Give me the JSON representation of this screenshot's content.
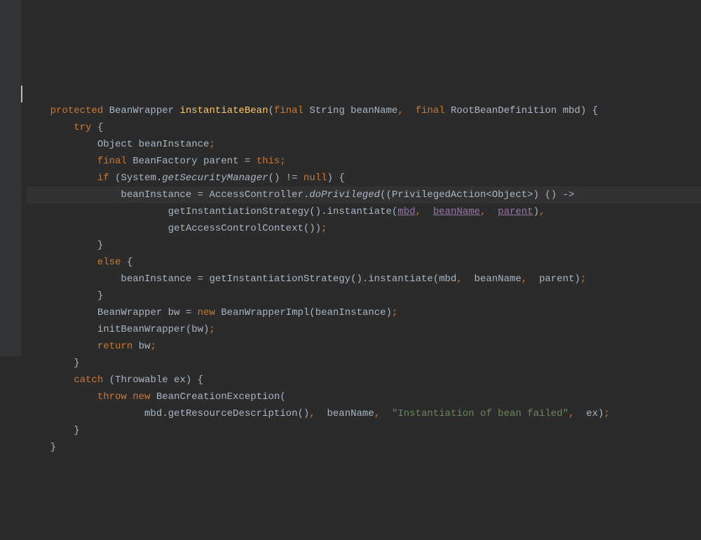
{
  "code": {
    "lines": [
      {
        "indent": 1,
        "tokens": [
          {
            "t": "protected ",
            "c": "kw"
          },
          {
            "t": "BeanWrapper ",
            "c": ""
          },
          {
            "t": "instantiateBean",
            "c": "method-decl"
          },
          {
            "t": "(",
            "c": ""
          },
          {
            "t": "final ",
            "c": "kw"
          },
          {
            "t": "String beanName",
            "c": ""
          },
          {
            "t": ", ",
            "c": "kw"
          },
          {
            "t": " ",
            "c": ""
          },
          {
            "t": "final ",
            "c": "kw"
          },
          {
            "t": "RootBeanDefinition mbd) {",
            "c": ""
          }
        ]
      },
      {
        "indent": 2,
        "tokens": [
          {
            "t": "try ",
            "c": "kw"
          },
          {
            "t": "{",
            "c": ""
          }
        ]
      },
      {
        "indent": 3,
        "tokens": [
          {
            "t": "Object beanInstance",
            "c": ""
          },
          {
            "t": ";",
            "c": "kw"
          }
        ]
      },
      {
        "indent": 3,
        "tokens": [
          {
            "t": "final ",
            "c": "kw"
          },
          {
            "t": "BeanFactory parent = ",
            "c": ""
          },
          {
            "t": "this;",
            "c": "kw"
          }
        ]
      },
      {
        "indent": 3,
        "tokens": [
          {
            "t": "if ",
            "c": "kw"
          },
          {
            "t": "(System.",
            "c": ""
          },
          {
            "t": "getSecurityManager",
            "c": "italic"
          },
          {
            "t": "() != ",
            "c": ""
          },
          {
            "t": "null",
            "c": "kw"
          },
          {
            "t": ") {",
            "c": ""
          }
        ]
      },
      {
        "indent": 4,
        "highlight": true,
        "tokens": [
          {
            "t": "beanInstance = AccessController.",
            "c": ""
          },
          {
            "t": "doPrivileged",
            "c": "italic"
          },
          {
            "t": "((PrivilegedAction<Object>) () ->",
            "c": ""
          }
        ]
      },
      {
        "indent": 6,
        "tokens": [
          {
            "t": "getInstantiationStrategy().instantiate(",
            "c": ""
          },
          {
            "t": "mbd",
            "c": "param-underline"
          },
          {
            "t": ", ",
            "c": "kw"
          },
          {
            "t": " ",
            "c": ""
          },
          {
            "t": "beanName",
            "c": "param-underline"
          },
          {
            "t": ", ",
            "c": "kw"
          },
          {
            "t": " ",
            "c": ""
          },
          {
            "t": "parent",
            "c": "param-underline"
          },
          {
            "t": ")",
            "c": ""
          },
          {
            "t": ",",
            "c": "kw"
          }
        ]
      },
      {
        "indent": 6,
        "tokens": [
          {
            "t": "getAccessControlContext())",
            "c": ""
          },
          {
            "t": ";",
            "c": "kw"
          }
        ]
      },
      {
        "indent": 3,
        "tokens": [
          {
            "t": "}",
            "c": ""
          }
        ]
      },
      {
        "indent": 3,
        "tokens": [
          {
            "t": "else ",
            "c": "kw"
          },
          {
            "t": "{",
            "c": ""
          }
        ]
      },
      {
        "indent": 4,
        "tokens": [
          {
            "t": "beanInstance = getInstantiationStrategy().instantiate(mbd",
            "c": ""
          },
          {
            "t": ", ",
            "c": "kw"
          },
          {
            "t": " beanName",
            "c": ""
          },
          {
            "t": ", ",
            "c": "kw"
          },
          {
            "t": " parent)",
            "c": ""
          },
          {
            "t": ";",
            "c": "kw"
          }
        ]
      },
      {
        "indent": 3,
        "tokens": [
          {
            "t": "}",
            "c": ""
          }
        ]
      },
      {
        "indent": 3,
        "tokens": [
          {
            "t": "BeanWrapper bw = ",
            "c": ""
          },
          {
            "t": "new ",
            "c": "kw"
          },
          {
            "t": "BeanWrapperImpl(beanInstance)",
            "c": ""
          },
          {
            "t": ";",
            "c": "kw"
          }
        ]
      },
      {
        "indent": 3,
        "tokens": [
          {
            "t": "initBeanWrapper(bw)",
            "c": ""
          },
          {
            "t": ";",
            "c": "kw"
          }
        ]
      },
      {
        "indent": 3,
        "tokens": [
          {
            "t": "return ",
            "c": "kw"
          },
          {
            "t": "bw",
            "c": ""
          },
          {
            "t": ";",
            "c": "kw"
          }
        ]
      },
      {
        "indent": 2,
        "tokens": [
          {
            "t": "}",
            "c": ""
          }
        ]
      },
      {
        "indent": 2,
        "tokens": [
          {
            "t": "catch ",
            "c": "kw"
          },
          {
            "t": "(Throwable ex) {",
            "c": ""
          }
        ]
      },
      {
        "indent": 3,
        "tokens": [
          {
            "t": "throw new ",
            "c": "kw"
          },
          {
            "t": "BeanCreationException(",
            "c": ""
          }
        ]
      },
      {
        "indent": 5,
        "tokens": [
          {
            "t": "mbd.getResourceDescription()",
            "c": ""
          },
          {
            "t": ", ",
            "c": "kw"
          },
          {
            "t": " beanName",
            "c": ""
          },
          {
            "t": ", ",
            "c": "kw"
          },
          {
            "t": " ",
            "c": ""
          },
          {
            "t": "\"Instantiation of bean failed\"",
            "c": "str"
          },
          {
            "t": ", ",
            "c": "kw"
          },
          {
            "t": " ex)",
            "c": ""
          },
          {
            "t": ";",
            "c": "kw"
          }
        ]
      },
      {
        "indent": 2,
        "tokens": [
          {
            "t": "}",
            "c": ""
          }
        ]
      },
      {
        "indent": 1,
        "tokens": [
          {
            "t": "}",
            "c": ""
          }
        ]
      }
    ],
    "indent_unit": "    "
  }
}
